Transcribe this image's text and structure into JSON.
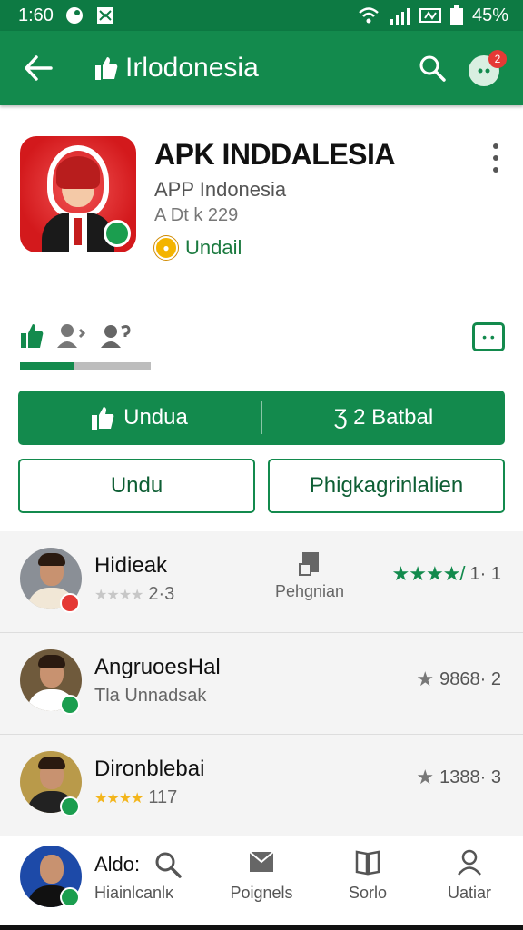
{
  "status_bar": {
    "time": "1:60",
    "battery": "45%"
  },
  "app_bar": {
    "title": "Irlodonesia",
    "notification_count": "2"
  },
  "app": {
    "name": "APK INDDALESIA",
    "developer": "APP Indonesia",
    "size": "A Dt k 229",
    "install_state": "Undail"
  },
  "reactions": {
    "progress_fraction": 0.42
  },
  "primary_button": {
    "left_label": "Unduа",
    "right_label": "Ʒ 2 Batbal"
  },
  "secondary_buttons": {
    "left_label": "Undu",
    "right_label": "Phigkagrinlalien"
  },
  "list": [
    {
      "name": "Hidieak",
      "rating_text": "2·3",
      "mid_label": "Pehgnian",
      "right_text": "1· 1"
    },
    {
      "name": "AngruoesHal",
      "sub": "Tla Unnadsak",
      "right_text": "9868· 2"
    },
    {
      "name": "Dironblebai",
      "rating_text": "117",
      "right_text": "1388· 3"
    }
  ],
  "bottom_nav": {
    "me_name": "Aldo:",
    "me_sub": "Hiainlcanlĸ",
    "items": [
      {
        "label": "Poignels",
        "icon": "mail-icon"
      },
      {
        "label": "Sorlo",
        "icon": "book-icon"
      },
      {
        "label": "Uatiar",
        "icon": "person-icon"
      }
    ]
  },
  "colors": {
    "brand_green": "#138a4d",
    "dark_green": "#0d7a43",
    "star_yellow": "#f3b51b",
    "badge_red": "#e53935"
  }
}
